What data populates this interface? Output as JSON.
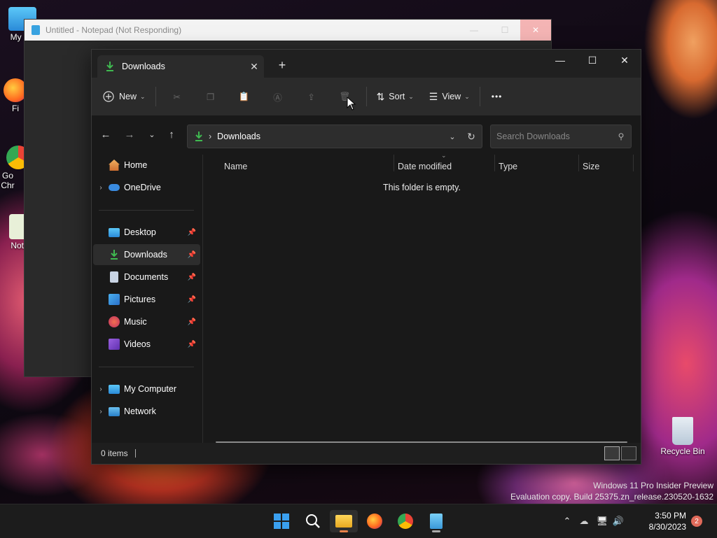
{
  "desktop": {
    "icons": [
      {
        "label": "My Co",
        "color": "#3ab0e8"
      },
      {
        "label": "Fi",
        "color": "#ff6a20"
      },
      {
        "label": "Go Chr",
        "color": "#34a853"
      },
      {
        "label": "Note",
        "color": "#6ab04c"
      }
    ],
    "recycle_bin": "Recycle Bin",
    "watermark_line1": "Windows 11 Pro Insider Preview",
    "watermark_line2": "Evaluation copy. Build 25375.zn_release.230520-1632"
  },
  "notepad": {
    "title": "Untitled - Notepad (Not Responding)"
  },
  "explorer": {
    "tab_title": "Downloads",
    "tab_close": "✕",
    "new_tab": "+",
    "window_controls": {
      "minimize": "—",
      "maximize": "☐",
      "close": "✕"
    },
    "toolbar": {
      "new_label": "New",
      "sort_label": "Sort",
      "view_label": "View",
      "more_label": "•••"
    },
    "address": {
      "separator": "›",
      "path": "Downloads",
      "search_placeholder": "Search Downloads"
    },
    "nav": {
      "home": "Home",
      "onedrive": "OneDrive",
      "desktop": "Desktop",
      "downloads": "Downloads",
      "documents": "Documents",
      "pictures": "Pictures",
      "music": "Music",
      "videos": "Videos",
      "my_computer": "My Computer",
      "network": "Network"
    },
    "columns": {
      "name": "Name",
      "date_modified": "Date modified",
      "type": "Type",
      "size": "Size"
    },
    "empty_message": "This folder is empty.",
    "status_items": "0 items"
  },
  "taskbar": {
    "time": "3:50 PM",
    "date": "8/30/2023",
    "notification_count": "2"
  },
  "colors": {
    "accent_green": "#3fb950",
    "onedrive_blue": "#3a8be0"
  }
}
